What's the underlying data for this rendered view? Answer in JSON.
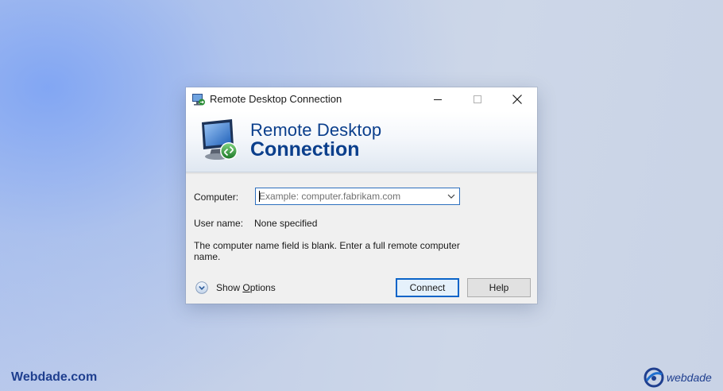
{
  "window": {
    "title": "Remote Desktop Connection",
    "controls": {
      "minimize": "minimize-icon",
      "maximize": "maximize-icon",
      "close": "close-icon"
    }
  },
  "banner": {
    "line1": "Remote Desktop",
    "line2": "Connection",
    "icon": "remote-desktop-monitor-icon"
  },
  "form": {
    "computer_label": "Computer:",
    "computer_value": "",
    "computer_placeholder": "Example: computer.fabrikam.com",
    "username_label": "User name:",
    "username_value": "None specified",
    "message": "The computer name field is blank. Enter a full remote computer name."
  },
  "footer": {
    "show_options_prefix": "Show ",
    "show_options_accel": "O",
    "show_options_suffix": "ptions",
    "connect_label": "Connect",
    "help_label": "Help"
  },
  "watermarks": {
    "left": "Webdade.com",
    "right": "webdade"
  },
  "colors": {
    "banner_text": "#0b3f8c",
    "focus_border": "#2d6fbe",
    "default_button_border": "#0a64c8",
    "watermark": "#1f3f8f"
  }
}
